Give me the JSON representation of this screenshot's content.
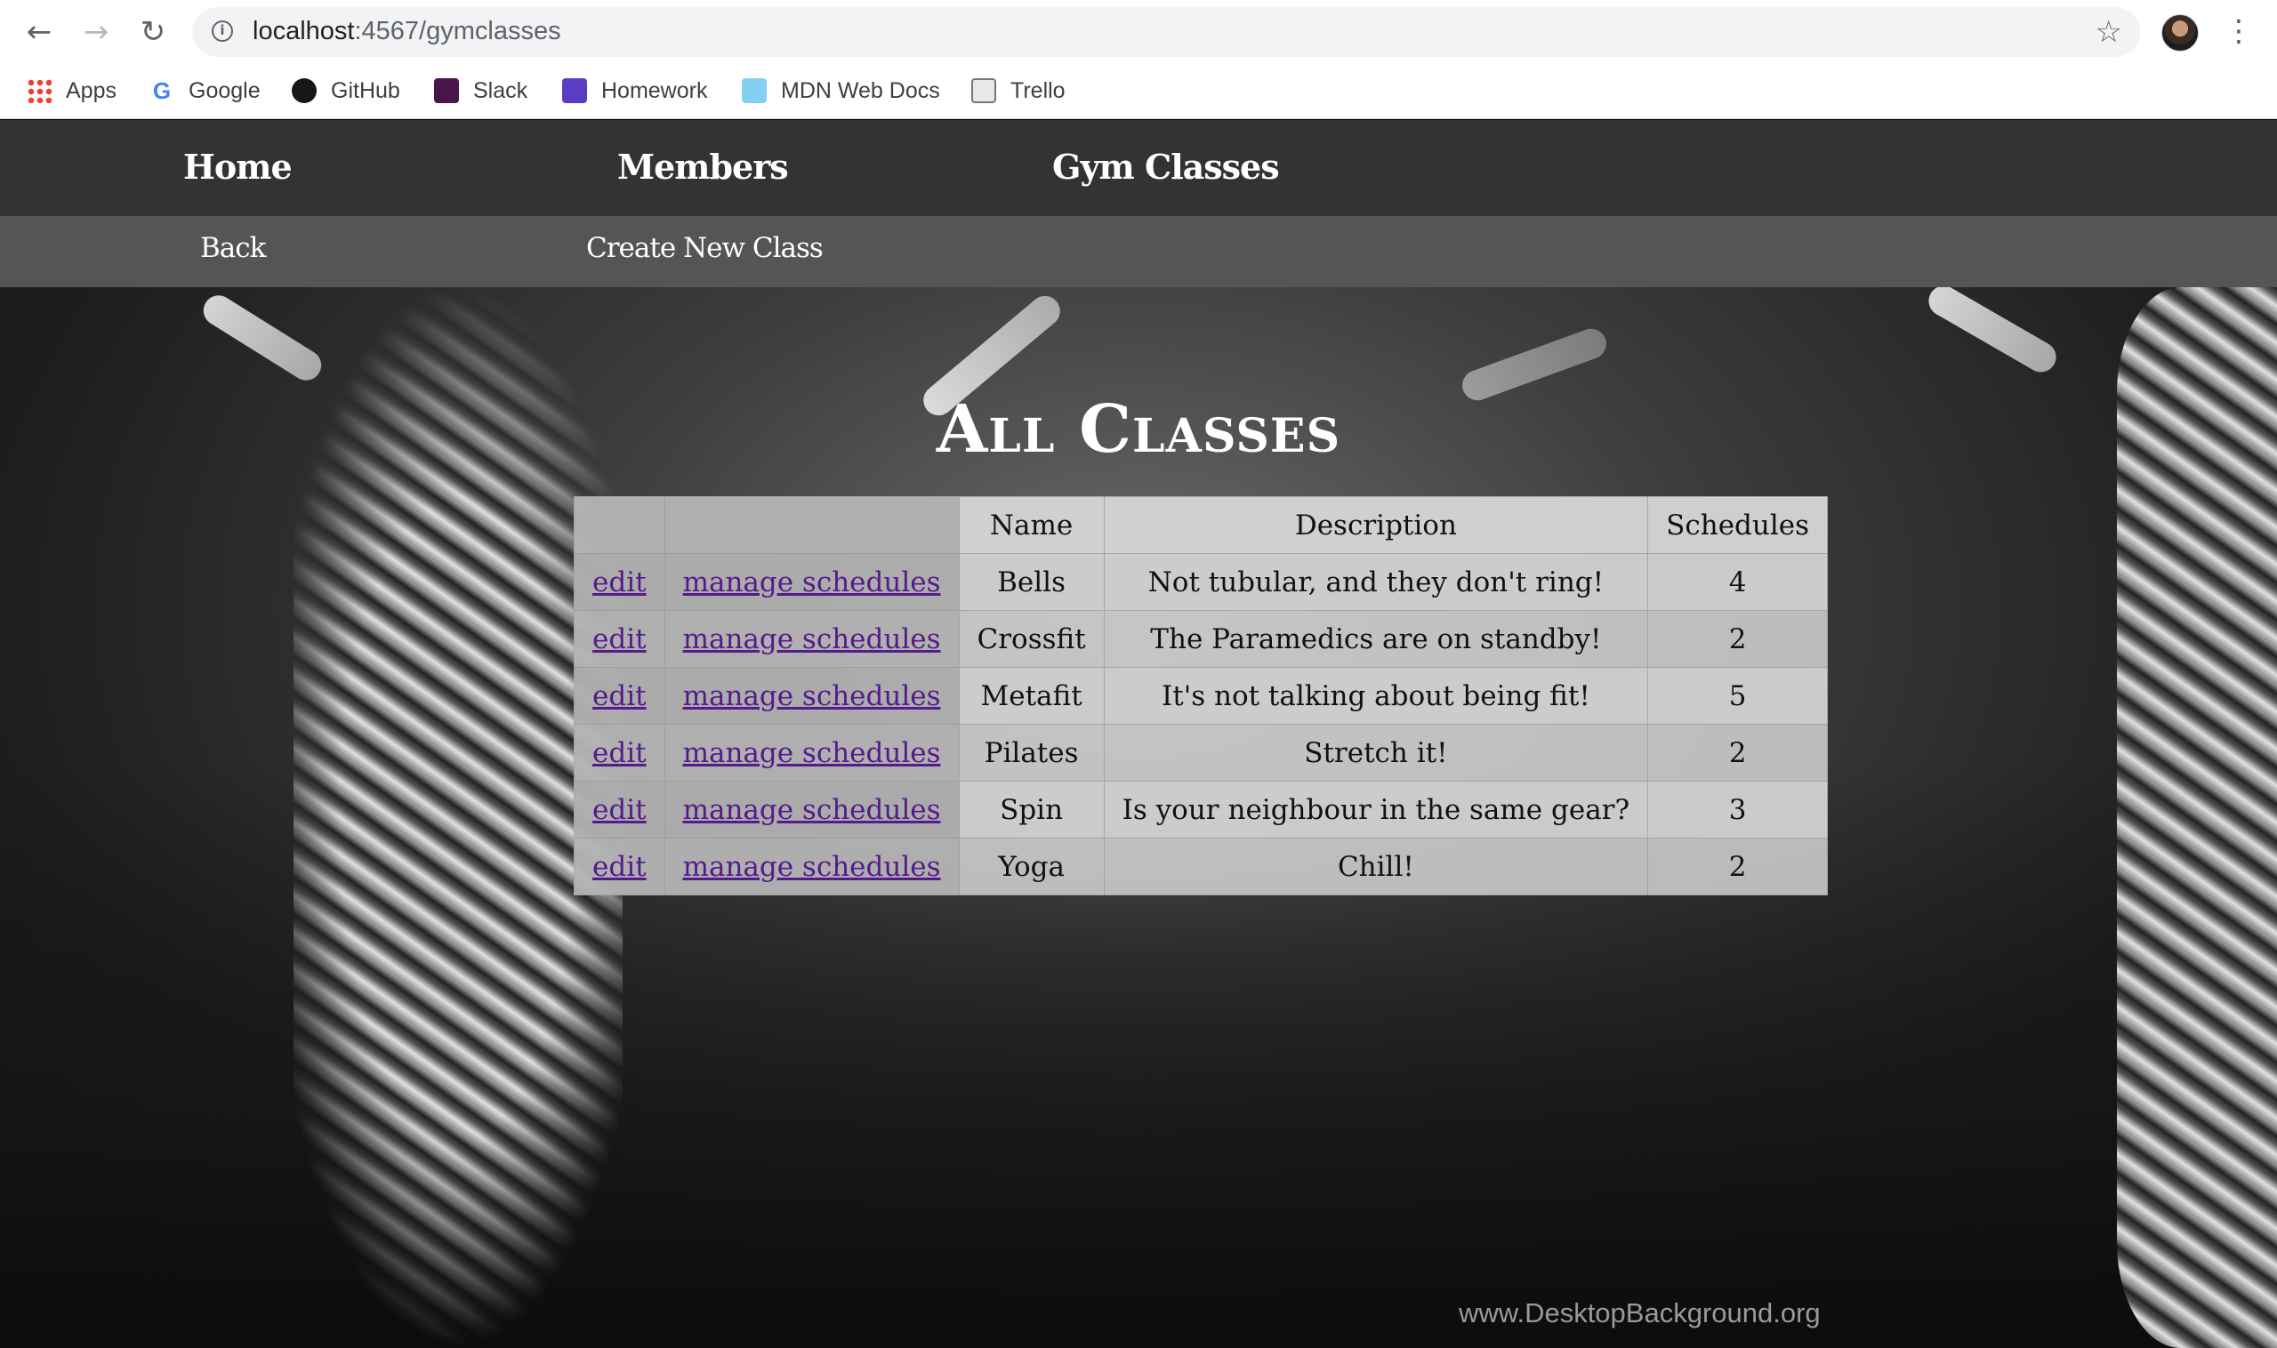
{
  "browser": {
    "url_host": "localhost",
    "url_path": ":4567/gymclasses",
    "bookmarks": [
      {
        "label": "Apps",
        "icon": "apps-grid-icon"
      },
      {
        "label": "Google",
        "icon": "google-icon"
      },
      {
        "label": "GitHub",
        "icon": "github-icon"
      },
      {
        "label": "Slack",
        "icon": "slack-icon"
      },
      {
        "label": "Homework",
        "icon": "homework-icon"
      },
      {
        "label": "MDN Web Docs",
        "icon": "mdn-icon"
      },
      {
        "label": "Trello",
        "icon": "trello-icon"
      }
    ]
  },
  "nav": {
    "home": "Home",
    "members": "Members",
    "gym_classes": "Gym Classes"
  },
  "subnav": {
    "back": "Back",
    "create": "Create New Class"
  },
  "page": {
    "title": "All Classes",
    "watermark": "www.DesktopBackground.org"
  },
  "table": {
    "headers": [
      "",
      "",
      "Name",
      "Description",
      "Schedules"
    ],
    "edit_label": "edit",
    "manage_label": "manage schedules",
    "rows": [
      {
        "name": "Bells",
        "description": "Not tubular, and they don't ring!",
        "schedules": "4"
      },
      {
        "name": "Crossfit",
        "description": "The Paramedics are on standby!",
        "schedules": "2"
      },
      {
        "name": "Metafit",
        "description": "It's not talking about being fit!",
        "schedules": "5"
      },
      {
        "name": "Pilates",
        "description": "Stretch it!",
        "schedules": "2"
      },
      {
        "name": "Spin",
        "description": "Is your neighbour in the same gear?",
        "schedules": "3"
      },
      {
        "name": "Yoga",
        "description": "Chill!",
        "schedules": "2"
      }
    ]
  }
}
